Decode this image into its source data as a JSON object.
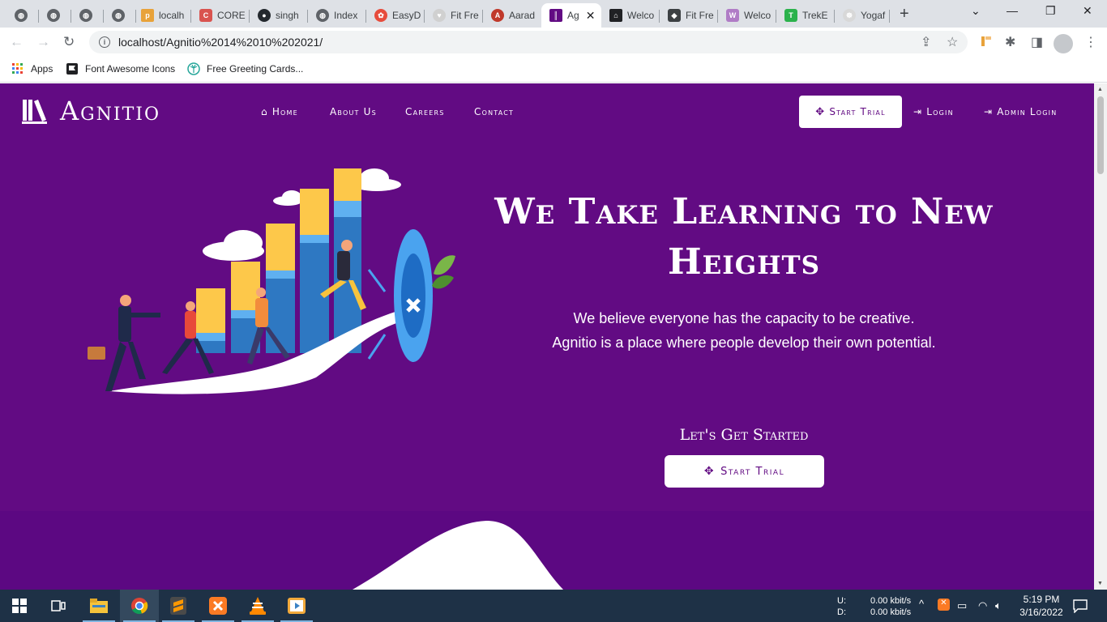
{
  "browser": {
    "tabs": [
      {
        "title": "",
        "icon": "globe-icon"
      },
      {
        "title": "",
        "icon": "globe-icon"
      },
      {
        "title": "",
        "icon": "globe-icon"
      },
      {
        "title": "",
        "icon": "globe-icon"
      },
      {
        "title": "localh",
        "icon": "phpmyadmin-icon"
      },
      {
        "title": "CORE",
        "icon": "core-icon"
      },
      {
        "title": "singh",
        "icon": "github-icon"
      },
      {
        "title": "Index",
        "icon": "globe-icon"
      },
      {
        "title": "EasyD",
        "icon": "easy-icon"
      },
      {
        "title": "Fit Fre",
        "icon": "fit-icon"
      },
      {
        "title": "Aarad",
        "icon": "aarad-icon"
      },
      {
        "title": "Ag",
        "icon": "agnitio-icon"
      },
      {
        "title": "Welco",
        "icon": "temple-icon"
      },
      {
        "title": "Fit Fre",
        "icon": "shield-icon"
      },
      {
        "title": "Welco",
        "icon": "welco-icon"
      },
      {
        "title": "TrekE",
        "icon": "trek-icon"
      },
      {
        "title": "Yogaf",
        "icon": "yoga-icon"
      }
    ],
    "url": "localhost/Agnitio%2014%2010%202021/",
    "bookmarks": [
      {
        "label": "Apps",
        "icon": "apps-grid-icon"
      },
      {
        "label": "Font Awesome Icons",
        "icon": "flag-icon"
      },
      {
        "label": "Free Greeting Cards...",
        "icon": "palm-icon"
      }
    ]
  },
  "site": {
    "brand": "Agnitio",
    "nav": [
      {
        "label": "Home",
        "icon": "home-icon"
      },
      {
        "label": "About Us",
        "icon": ""
      },
      {
        "label": "Careers",
        "icon": ""
      },
      {
        "label": "Contact",
        "icon": ""
      }
    ],
    "start_trial": "Start Trial",
    "login": "Login",
    "admin_login": "Admin Login",
    "hero_title": "We Take Learning to New Heights",
    "hero_line1": "We believe everyone has the capacity to be creative.",
    "hero_line2": "Agnitio is a place where people develop their own potential.",
    "cta_label": "Let's Get Started",
    "cta_button": "Start Trial",
    "colors": {
      "primary": "#620b83",
      "button_bg": "#ffffff"
    }
  },
  "taskbar": {
    "net_up_label": "U:",
    "net_down_label": "D:",
    "net_up": "0.00 kbit/s",
    "net_down": "0.00 kbit/s",
    "time": "5:19 PM",
    "date": "3/16/2022",
    "apps": [
      "windows-start-icon",
      "task-view-icon",
      "file-explorer-icon",
      "chrome-icon",
      "sublime-icon",
      "xampp-icon",
      "vlc-icon",
      "media-player-icon"
    ]
  }
}
